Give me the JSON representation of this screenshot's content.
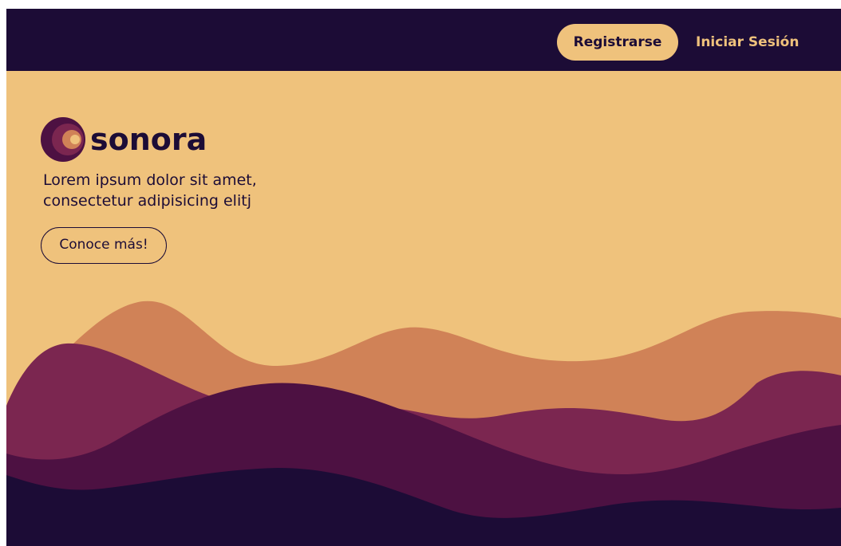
{
  "nav": {
    "register_label": "Registrarse",
    "login_label": "Iniciar Sesión"
  },
  "hero": {
    "brand_name": "sonora",
    "tagline_line1": "Lorem ipsum dolor sit amet,",
    "tagline_line2": "consectetur adipisicing elitj",
    "cta_label": "Conoce más!"
  },
  "colors": {
    "navy": "#1c0c36",
    "sand": "#efc27c",
    "orange": "#d08257",
    "berry": "#7b2650",
    "plum": "#4d1142"
  },
  "icons": {
    "logo": "sonora-logo-icon"
  }
}
